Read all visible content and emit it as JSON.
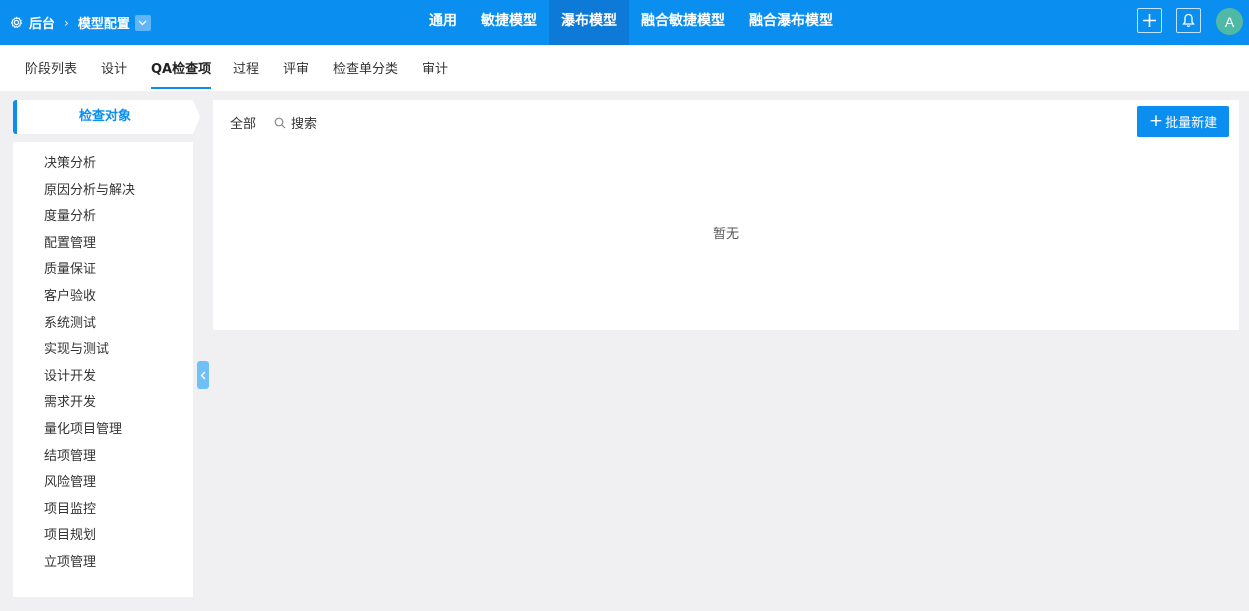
{
  "topbar": {
    "backend_label": "后台",
    "breadcrumb_current": "模型配置",
    "nav": [
      "通用",
      "敏捷模型",
      "瀑布模型",
      "融合敏捷模型",
      "融合瀑布模型"
    ],
    "active_nav": "瀑布模型",
    "avatar_letter": "A"
  },
  "subtabs": {
    "items": [
      "阶段列表",
      "设计",
      "QA检查项",
      "过程",
      "评审",
      "检查单分类",
      "审计"
    ],
    "active": "QA检查项"
  },
  "sidebar": {
    "title": "检查对象",
    "items": [
      "决策分析",
      "原因分析与解决",
      "度量分析",
      "配置管理",
      "质量保证",
      "客户验收",
      "系统测试",
      "实现与测试",
      "设计开发",
      "需求开发",
      "量化项目管理",
      "结项管理",
      "风险管理",
      "项目监控",
      "项目规划",
      "立项管理"
    ]
  },
  "main": {
    "filter_all": "全部",
    "search_label": "搜索",
    "batch_new_label": "批量新建",
    "empty_text": "暂无"
  },
  "colors": {
    "accent": "#0a8ef0",
    "active_nav_bg": "#0c7ad6",
    "avatar_bg": "#50b9a5",
    "page_bg": "#f0f0f2"
  }
}
